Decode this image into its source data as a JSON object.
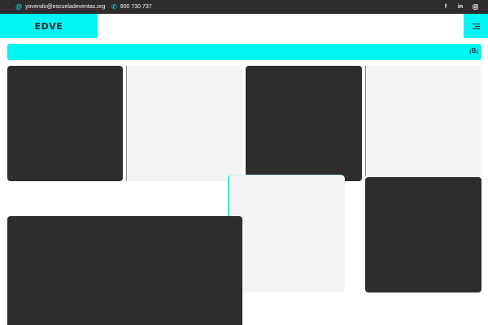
{
  "topbar": {
    "email": "yovendo@escueladeventas.org",
    "phone": "900 730 737",
    "social": [
      "f",
      "in",
      "ig"
    ]
  },
  "header": {
    "logo": "EDVE"
  },
  "banner": {
    "text": "¡B¡"
  },
  "colors": {
    "accent": "#00f5f5",
    "dark": "#2e2c2d",
    "light": "#f4f4f4"
  }
}
